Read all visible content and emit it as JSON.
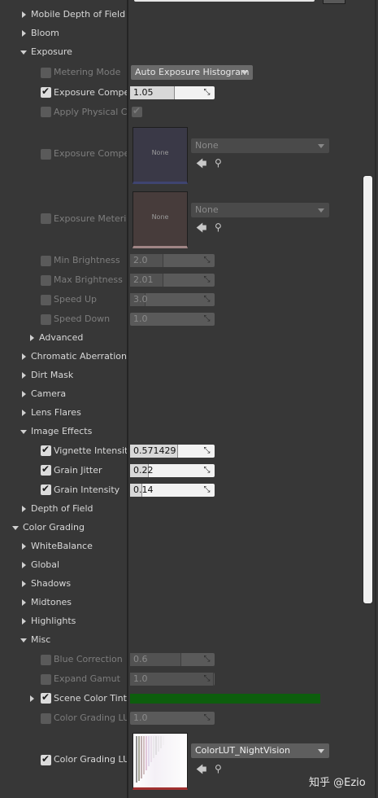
{
  "tree": {
    "mobile_dof": "Mobile Depth of Field",
    "bloom": "Bloom",
    "exposure": "Exposure",
    "advanced": "Advanced",
    "chromatic_aberration": "Chromatic Aberration",
    "dirt_mask": "Dirt Mask",
    "camera": "Camera",
    "lens_flares": "Lens Flares",
    "image_effects": "Image Effects",
    "depth_of_field": "Depth of Field",
    "color_grading": "Color Grading",
    "white_balance": "WhiteBalance",
    "global": "Global",
    "shadows": "Shadows",
    "midtones": "Midtones",
    "highlights": "Highlights",
    "misc": "Misc"
  },
  "exposure": {
    "metering_mode_label": "Metering Mode",
    "metering_mode_value": "Auto Exposure Histogram",
    "exposure_comp_label": "Exposure Compen",
    "exposure_comp_value": "1.05",
    "apply_physical_label": "Apply Physical Ca",
    "exposure_curve_label": "Exposure Compen",
    "exposure_curve_thumb": "None",
    "exposure_curve_combo": "None",
    "exposure_mask_label": "Exposure Meterin",
    "exposure_mask_thumb": "None",
    "exposure_mask_combo": "None",
    "min_brightness_label": "Min Brightness",
    "min_brightness_value": "2.0",
    "max_brightness_label": "Max Brightness",
    "max_brightness_value": "2.01",
    "speed_up_label": "Speed Up",
    "speed_up_value": "3.0",
    "speed_down_label": "Speed Down",
    "speed_down_value": "1.0"
  },
  "image_effects": {
    "vignette_label": "Vignette Intensity",
    "vignette_value": "0.571429",
    "vignette_fill": 0.57,
    "grain_jitter_label": "Grain Jitter",
    "grain_jitter_value": "0.22",
    "grain_intensity_label": "Grain Intensity",
    "grain_intensity_value": "0.14"
  },
  "misc": {
    "blue_correction_label": "Blue Correction",
    "blue_correction_value": "0.6",
    "expand_gamut_label": "Expand Gamut",
    "expand_gamut_value": "1.0",
    "scene_color_tint_label": "Scene Color Tint",
    "scene_color_tint_color": "#0d5e0d",
    "lut_intensity_label": "Color Grading LUT",
    "lut_intensity_value": "1.0",
    "lut_label": "Color Grading LUT",
    "lut_value": "ColorLUT_NightVision"
  },
  "watermark": "知乎 @Ezio"
}
